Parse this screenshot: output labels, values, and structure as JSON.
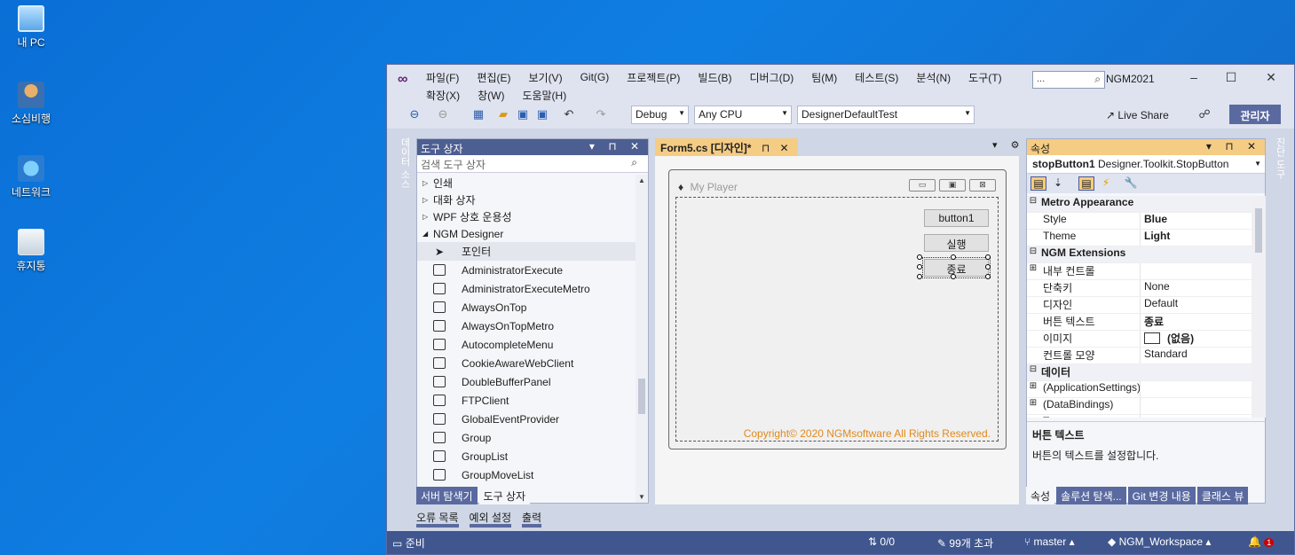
{
  "desktop": {
    "icons": [
      {
        "label": "내 PC",
        "icon": "computer-icon"
      },
      {
        "label": "소심비행",
        "icon": "user-folder-icon"
      },
      {
        "label": "네트워크",
        "icon": "network-icon"
      },
      {
        "label": "휴지통",
        "icon": "recycle-bin-icon"
      }
    ]
  },
  "vs": {
    "menu_row1": [
      "파일(F)",
      "편집(E)",
      "보기(V)",
      "Git(G)",
      "프로젝트(P)",
      "빌드(B)",
      "디버그(D)",
      "팀(M)",
      "테스트(S)",
      "분석(N)",
      "도구(T)"
    ],
    "menu_row2": [
      "확장(X)",
      "창(W)",
      "도움말(H)"
    ],
    "search_placeholder": "...",
    "project_name": "NGM2021",
    "toolbar": {
      "config": "Debug",
      "platform": "Any CPU",
      "startup": "DesignerDefaultTest",
      "live_share": "Live Share",
      "admin": "관리자"
    },
    "left_strip": "데이터 소스",
    "right_strip": "진단 도구"
  },
  "toolbox": {
    "title": "도구 상자",
    "search_placeholder": "검색 도구 상자",
    "items": [
      {
        "kind": "cat",
        "expanded": false,
        "label": "인쇄"
      },
      {
        "kind": "cat",
        "expanded": false,
        "label": "대화 상자"
      },
      {
        "kind": "cat",
        "expanded": false,
        "label": "WPF 상호 운용성"
      },
      {
        "kind": "cat",
        "expanded": true,
        "label": "NGM Designer"
      },
      {
        "kind": "pointer",
        "label": "포인터"
      },
      {
        "kind": "ctl",
        "label": "AdministratorExecute"
      },
      {
        "kind": "ctl",
        "label": "AdministratorExecuteMetro"
      },
      {
        "kind": "ctl",
        "label": "AlwaysOnTop"
      },
      {
        "kind": "ctl",
        "label": "AlwaysOnTopMetro"
      },
      {
        "kind": "ctl",
        "label": "AutocompleteMenu"
      },
      {
        "kind": "ctl",
        "label": "CookieAwareWebClient"
      },
      {
        "kind": "ctl",
        "label": "DoubleBufferPanel"
      },
      {
        "kind": "ctl",
        "label": "FTPClient"
      },
      {
        "kind": "ctl",
        "label": "GlobalEventProvider"
      },
      {
        "kind": "ctl",
        "label": "Group"
      },
      {
        "kind": "ctl",
        "label": "GroupList"
      },
      {
        "kind": "ctl",
        "label": "GroupMoveList"
      }
    ],
    "tabs": [
      "서버 탐색기",
      "도구 상자"
    ],
    "bottom_tabs": [
      "오류 목록",
      "예외 설정",
      "출력"
    ]
  },
  "document": {
    "tab_label": "Form5.cs [디자인]*",
    "form": {
      "title": "My Player",
      "buttons": [
        "button1",
        "실행",
        "종료"
      ],
      "copyright": "Copyright© 2020 NGMsoftware All Rights Reserved."
    }
  },
  "properties": {
    "title": "속성",
    "object_name": "stopButton1",
    "object_type": "Designer.Toolkit.StopButton",
    "rows": [
      {
        "type": "cat",
        "label": "Metro Appearance"
      },
      {
        "type": "prop",
        "key": "Style",
        "value": "Blue",
        "bold": true
      },
      {
        "type": "prop",
        "key": "Theme",
        "value": "Light",
        "bold": true
      },
      {
        "type": "cat",
        "label": "NGM Extensions"
      },
      {
        "type": "prop",
        "key": "내부 컨트롤",
        "value": "",
        "expandable": true
      },
      {
        "type": "prop",
        "key": "단축키",
        "value": "None"
      },
      {
        "type": "prop",
        "key": "디자인",
        "value": "Default"
      },
      {
        "type": "prop",
        "key": "버튼 텍스트",
        "value": "종료",
        "bold": true
      },
      {
        "type": "prop",
        "key": "이미지",
        "value": "(없음)",
        "swatch": true
      },
      {
        "type": "prop",
        "key": "컨트롤 모양",
        "value": "Standard"
      },
      {
        "type": "cat",
        "label": "데이터"
      },
      {
        "type": "prop",
        "key": "(ApplicationSettings)",
        "value": "",
        "expandable": true
      },
      {
        "type": "prop",
        "key": "(DataBindings)",
        "value": "",
        "expandable": true
      },
      {
        "type": "prop",
        "key": "Tag",
        "value": ""
      }
    ],
    "desc_title": "버튼 텍스트",
    "desc_text": "버튼의 텍스트를 설정합니다.",
    "tabs": [
      "속성",
      "솔루션 탐색...",
      "Git 변경 내용",
      "클래스 뷰"
    ]
  },
  "status": {
    "ready": "준비",
    "errors": "0/0",
    "changes": "99개 초과",
    "branch": "master",
    "repo": "NGM_Workspace",
    "notifications": "1"
  },
  "colors": {
    "desktop": "#0f7ee2",
    "vs_frame": "#5a6aa0",
    "active_tab": "#f5cc84",
    "status_bar": "#40568f",
    "copyright_text": "#e08a1e"
  }
}
